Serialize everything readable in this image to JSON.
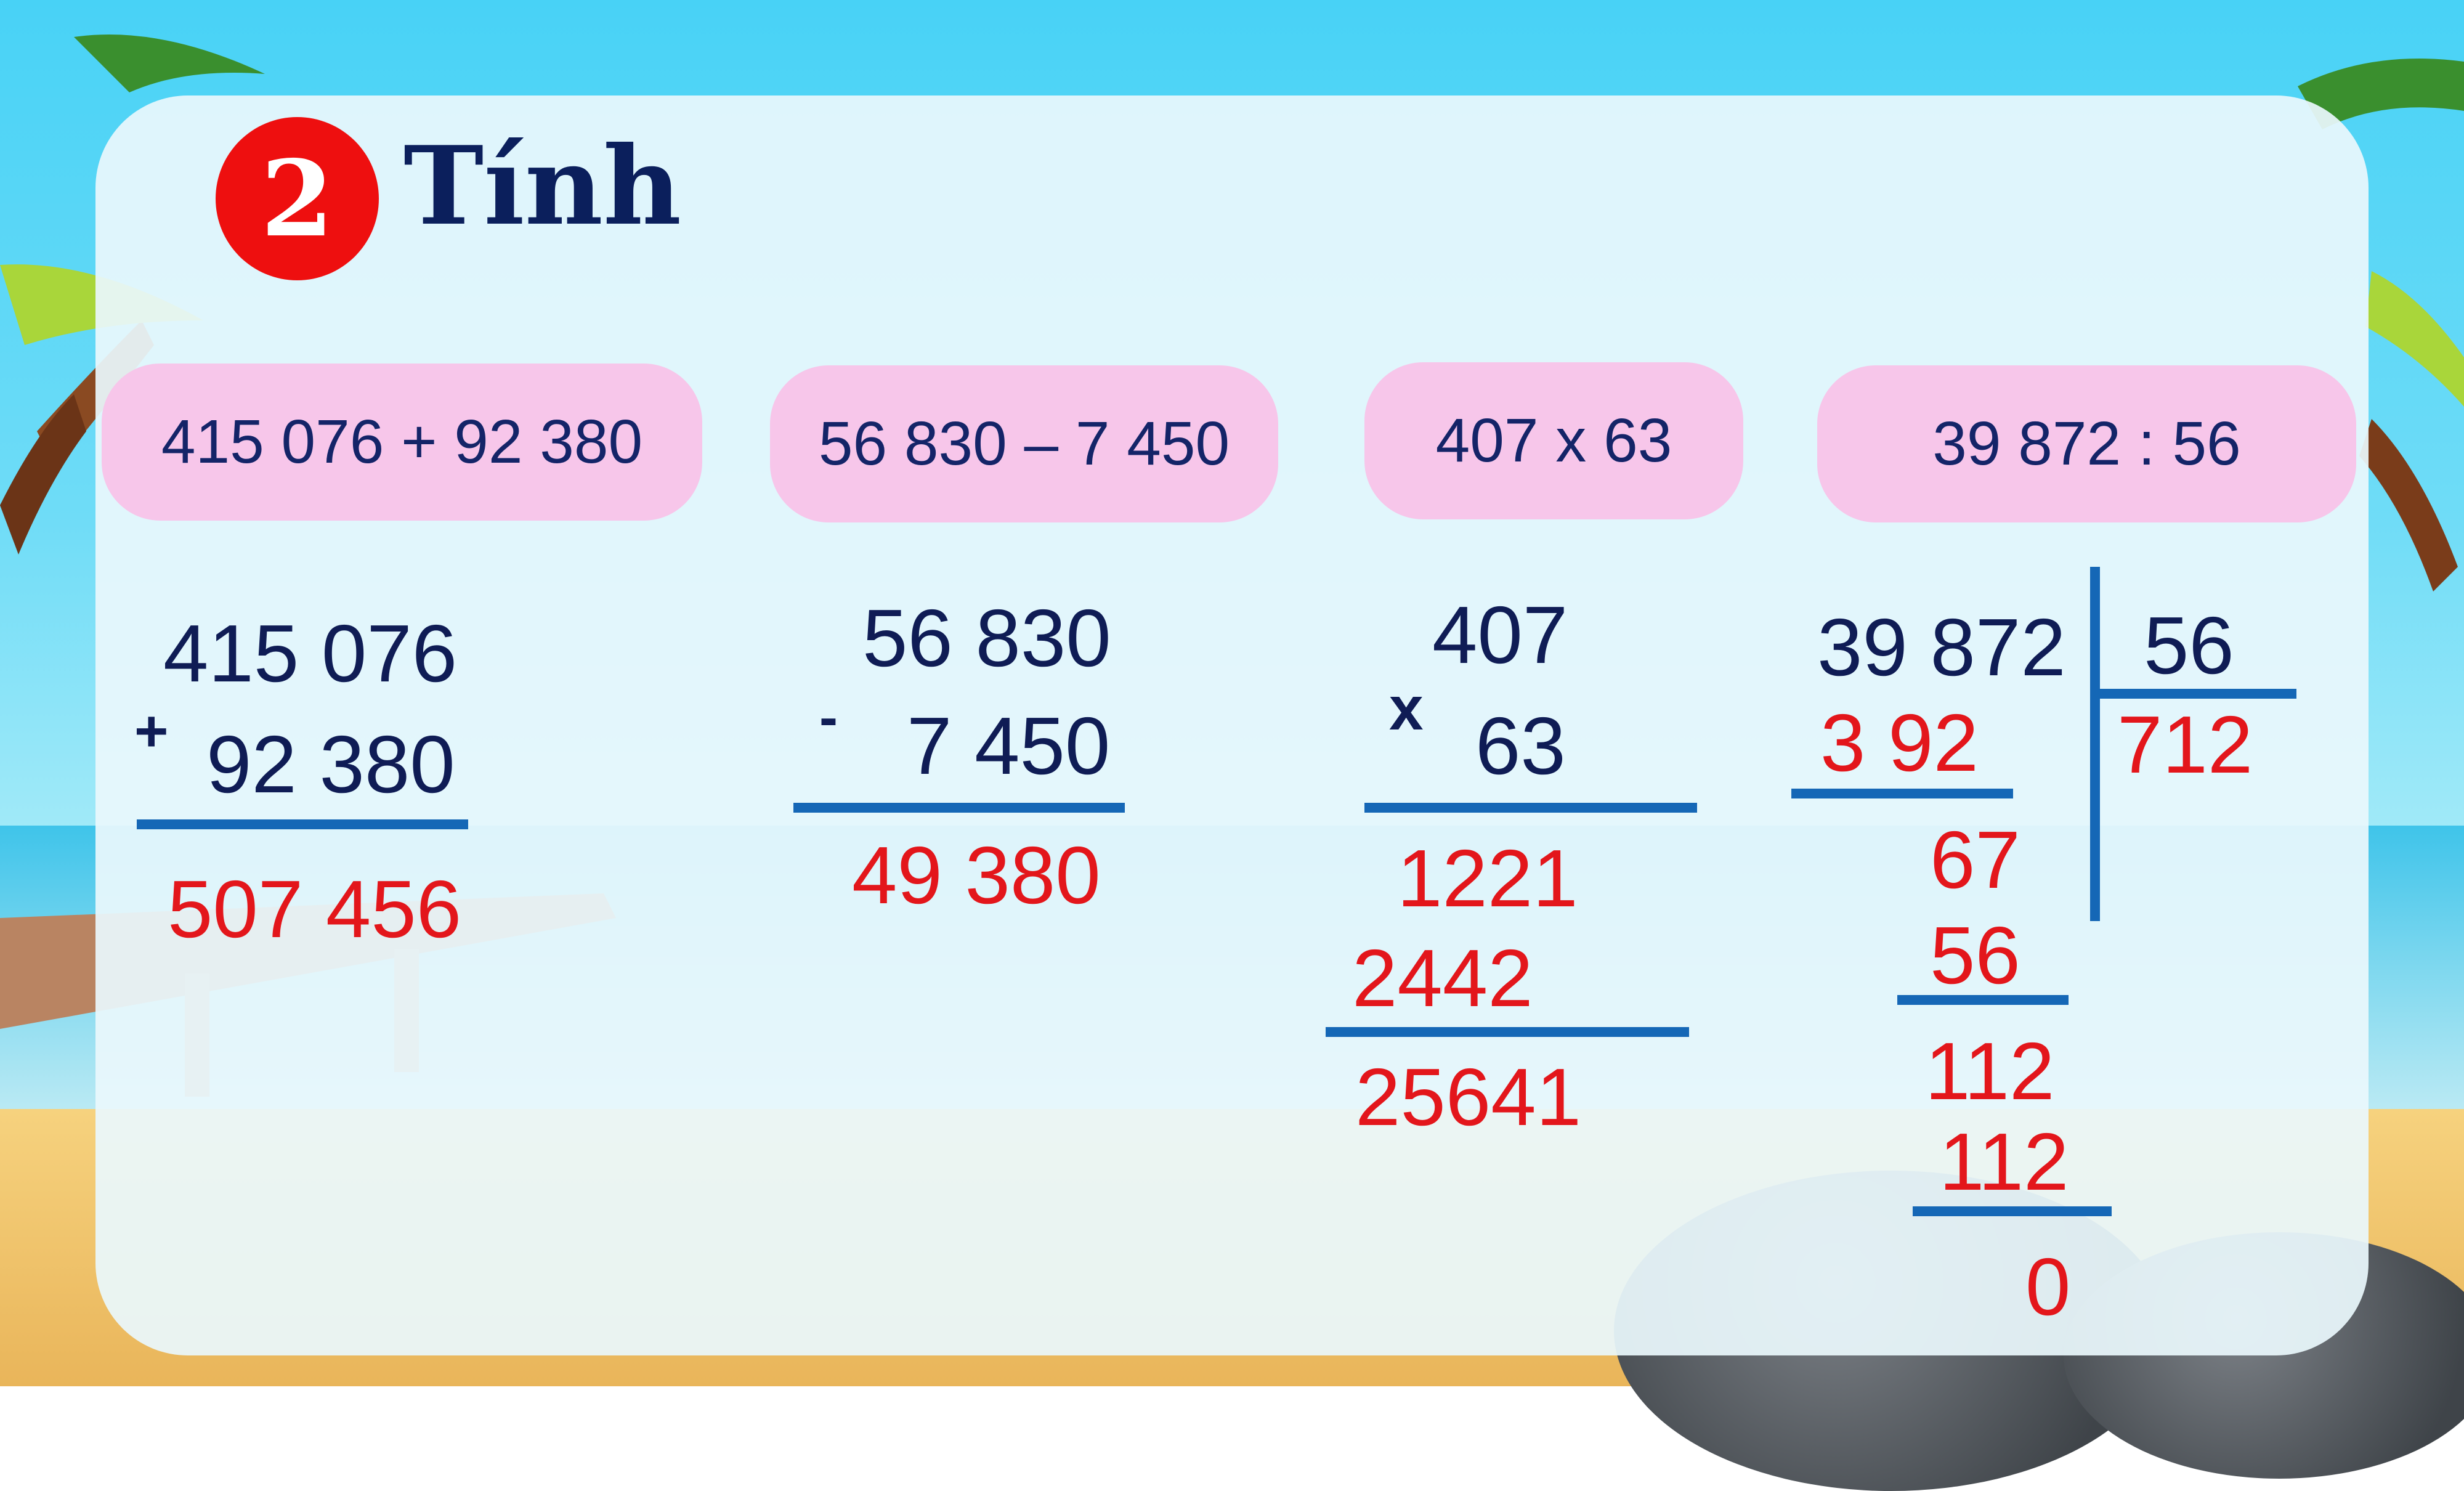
{
  "heading": {
    "number": "2",
    "title": "Tính"
  },
  "problems": [
    "415 076 + 92 380",
    "56 830 – 7 450",
    "407 x 63",
    "39 872 : 56"
  ],
  "addition": {
    "top": "415 076",
    "operator": "+",
    "bottom": "92 380",
    "result": "507 456"
  },
  "subtraction": {
    "top": "56 830",
    "operator": "-",
    "bottom": "7 450",
    "result": "49 380"
  },
  "multiplication": {
    "top": "407",
    "operator": "x",
    "bottom": "63",
    "partial1": "1221",
    "partial2": "2442",
    "result": "25641"
  },
  "division": {
    "dividend": "39 872",
    "divisor": "56",
    "quotient": "712",
    "step1": "3 92",
    "step2": "67",
    "step3": "56",
    "step4": "112",
    "step5": "112",
    "remainder": "0"
  }
}
